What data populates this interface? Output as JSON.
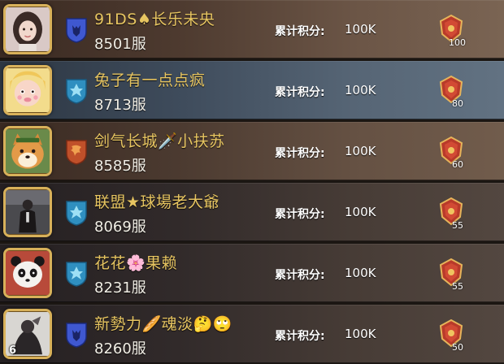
{
  "score_label": "累计积分:",
  "entries": [
    {
      "player_name": "91DS♠长乐未央",
      "server": "8501服",
      "score": "100K",
      "rank_value": "100",
      "avatar_icon": "girl-portrait-icon",
      "emblem_icon": "wolf-shield-emblem-icon",
      "emblem_color": "#3f58d0"
    },
    {
      "player_name": "兔子有一点点疯",
      "server": "8713服",
      "score": "100K",
      "rank_value": "80",
      "avatar_icon": "blonde-cartoon-avatar-icon",
      "emblem_icon": "crystal-shield-emblem-icon",
      "emblem_color": "#2f8fc0"
    },
    {
      "player_name": "剑气长城🗡️小扶苏",
      "server": "8585服",
      "score": "100K",
      "rank_value": "60",
      "avatar_icon": "shiba-dog-avatar-icon",
      "emblem_icon": "dragon-shield-emblem-icon",
      "emblem_color": "#c0502a"
    },
    {
      "player_name": "联盟★球場老大爺",
      "server": "8069服",
      "score": "100K",
      "rank_value": "55",
      "avatar_icon": "suited-figure-avatar-icon",
      "emblem_icon": "crystal-shield-emblem-icon",
      "emblem_color": "#2f8fc0"
    },
    {
      "player_name": "花花🌸果赖",
      "server": "8231服",
      "score": "100K",
      "rank_value": "55",
      "avatar_icon": "panda-avatar-icon",
      "emblem_icon": "crystal-shield-emblem-icon",
      "emblem_color": "#2f8fc0"
    },
    {
      "player_name": "新勢力🥖魂淡🤔🙄",
      "server": "8260服",
      "score": "100K",
      "rank_value": "50",
      "avatar_level": "6",
      "avatar_icon": "masked-warrior-avatar-icon",
      "emblem_icon": "wolf-shield-emblem-icon",
      "emblem_color": "#3f58d0"
    }
  ]
}
